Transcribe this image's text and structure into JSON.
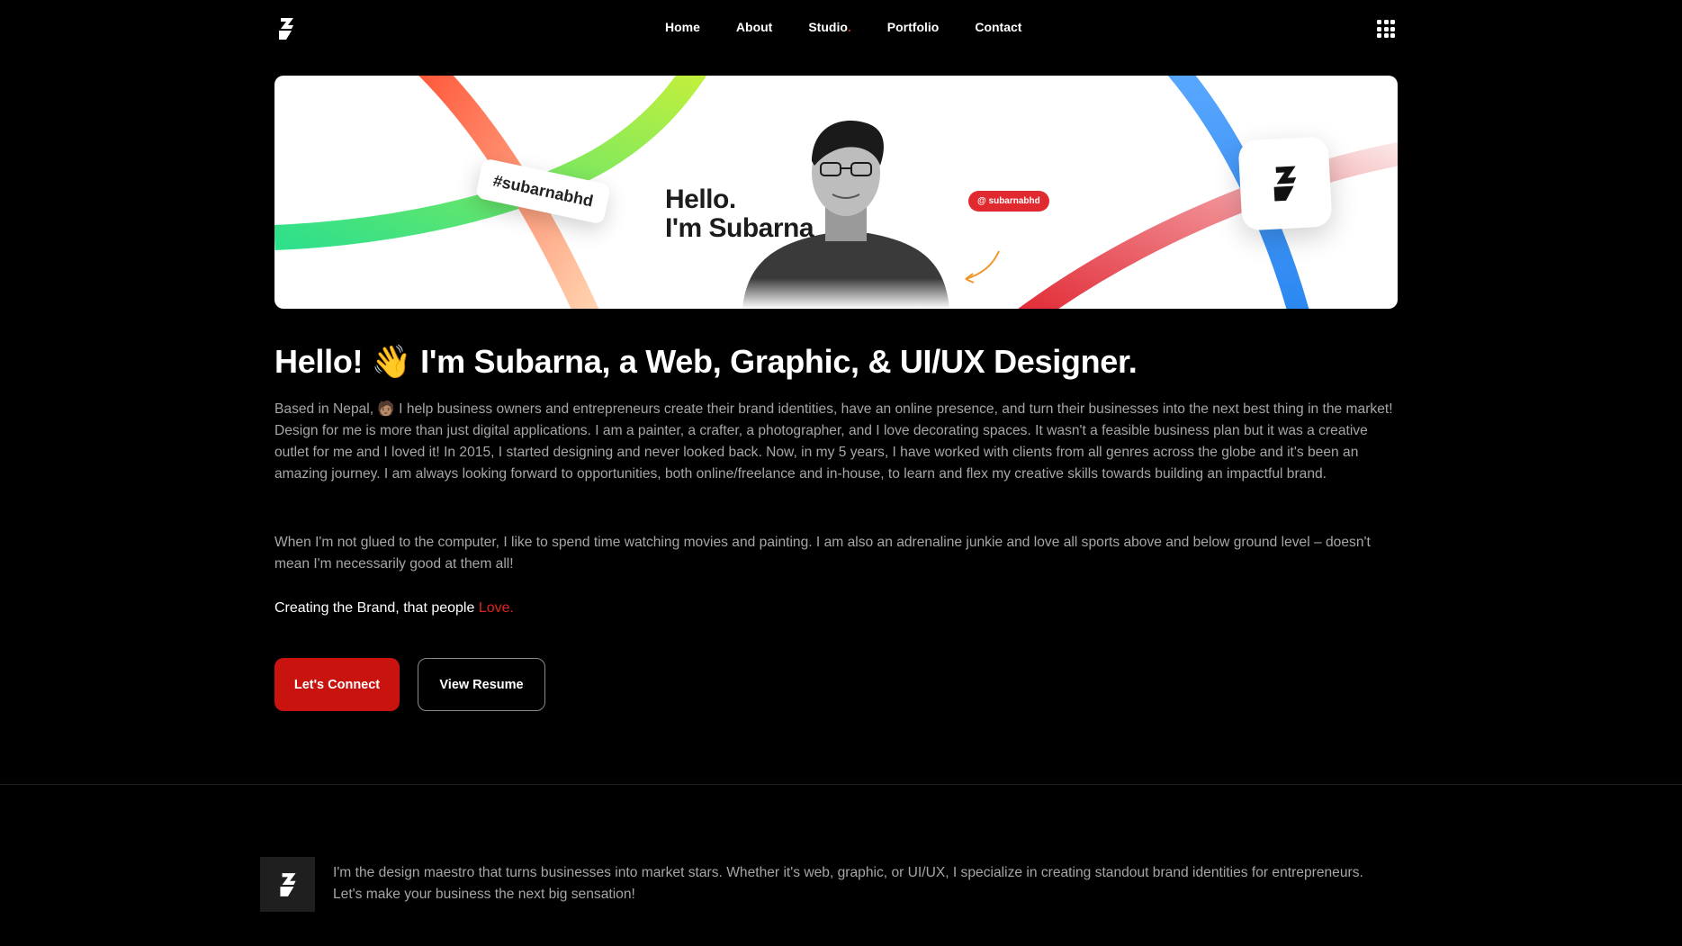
{
  "nav": {
    "items": [
      {
        "label": "Home"
      },
      {
        "label": "About"
      },
      {
        "label": "Studio",
        "suffix": "."
      },
      {
        "label": "Portfolio"
      },
      {
        "label": "Contact"
      }
    ],
    "logo_icon": "brand-logo-icon",
    "menu_icon": "grid-menu-icon"
  },
  "banner": {
    "hashtag": "#subarnabhd",
    "hello_line1": "Hello.",
    "hello_line2": "I'm Subarna",
    "handle": "@ subarnabhd"
  },
  "hero": {
    "headline": "Hello! 👋 I'm Subarna, a Web, Graphic, & UI/UX Designer.",
    "paragraph1": "Based in Nepal, 🧑🏽 I help business owners and entrepreneurs create their brand identities, have an online presence, and turn their businesses into the next best thing in the market! Design for me is more than just digital applications. I am a painter, a crafter, a photographer, and I love decorating spaces. It wasn't a feasible business plan but it was a creative outlet for me and I loved it! In 2015, I started designing and never looked back. Now, in my 5 years, I have worked with clients from all genres across the globe and it's been an amazing journey. I am always looking forward to opportunities, both online/freelance and in-house, to learn and flex my creative skills towards building an impactful brand.",
    "paragraph2": "When I'm not glued to the computer, I like to spend time watching movies and painting. I am also an adrenaline junkie and love all sports above and below ground level – doesn't mean I'm necessarily good at them all!",
    "tagline_prefix": "Creating the Brand, that people ",
    "tagline_accent": "Love.",
    "primary_button": "Let's Connect",
    "secondary_button": "View Resume"
  },
  "footer": {
    "text": "I'm the design maestro that turns businesses into market stars. Whether it's web, graphic, or UI/UX, I specialize in creating standout brand identities for entrepreneurs. Let's make your business the next big sensation!"
  },
  "colors": {
    "accent": "#e0221f",
    "button_primary": "#c8130f",
    "background": "#000000",
    "body_text": "#a6a6a6"
  }
}
